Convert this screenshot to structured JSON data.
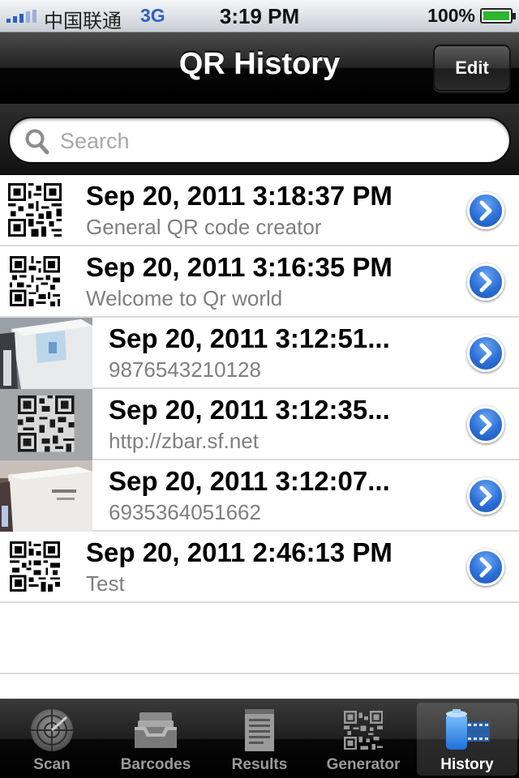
{
  "status_bar": {
    "carrier": "中国联通",
    "network": "3G",
    "time": "3:19 PM",
    "battery_percent": "100%",
    "battery_color": "#2fb52f"
  },
  "nav_bar": {
    "title": "QR History",
    "edit_label": "Edit"
  },
  "search": {
    "placeholder": "Search",
    "value": "",
    "icon": "search-icon"
  },
  "history": {
    "items": [
      {
        "date": "Sep 20, 2011 3:18:37 PM",
        "subtitle": "General QR code creator",
        "thumbnail": "qr-code-icon"
      },
      {
        "date": "Sep 20, 2011 3:16:35 PM",
        "subtitle": "Welcome to Qr world",
        "thumbnail": "qr-code-icon"
      },
      {
        "date": "Sep 20, 2011 3:12:51...",
        "subtitle": "9876543210128",
        "thumbnail": "scan-photo"
      },
      {
        "date": "Sep 20, 2011 3:12:35...",
        "subtitle": "http://zbar.sf.net",
        "thumbnail": "scan-photo"
      },
      {
        "date": "Sep 20, 2011 3:12:07...",
        "subtitle": "6935364051662",
        "thumbnail": "scan-photo"
      },
      {
        "date": "Sep 20, 2011 2:46:13 PM",
        "subtitle": "Test",
        "thumbnail": "qr-code-icon"
      }
    ]
  },
  "tab_bar": {
    "active": "History",
    "tabs": [
      {
        "label": "Scan",
        "icon": "radar-icon"
      },
      {
        "label": "Barcodes",
        "icon": "inbox-tray-icon"
      },
      {
        "label": "Results",
        "icon": "document-icon"
      },
      {
        "label": "Generator",
        "icon": "qr-code-icon"
      },
      {
        "label": "History",
        "icon": "film-reel-icon"
      }
    ]
  }
}
